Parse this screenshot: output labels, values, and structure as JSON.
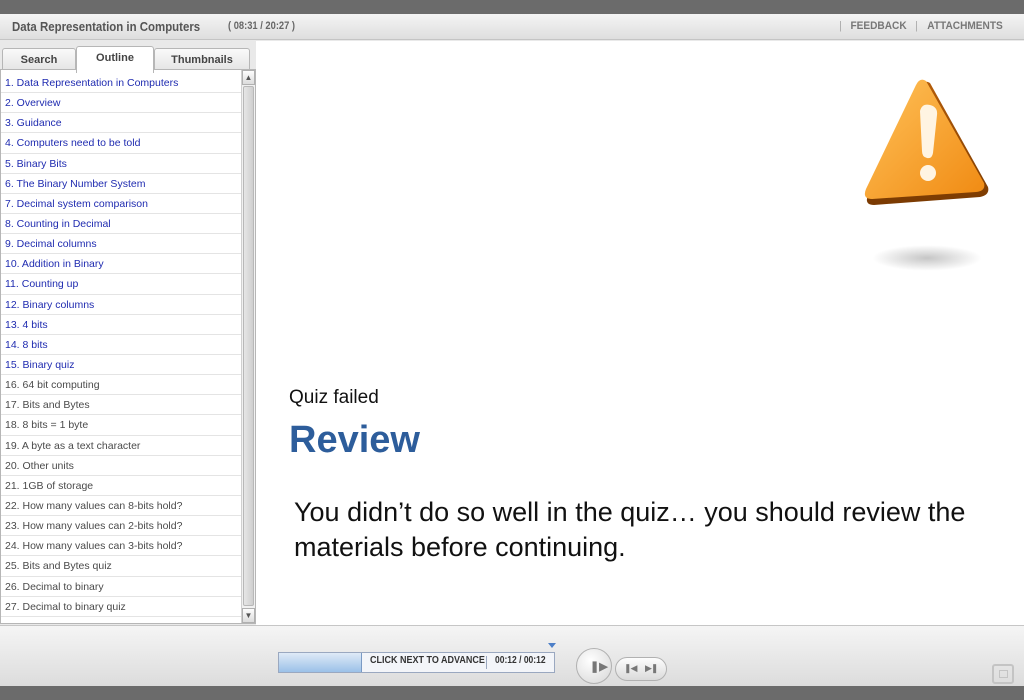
{
  "header": {
    "course_title": "Data Representation in Computers",
    "course_time": "( 08:31 / 20:27 )",
    "feedback_label": "FEEDBACK",
    "attachments_label": "ATTACHMENTS"
  },
  "sidebar": {
    "tabs": [
      {
        "label": "Search"
      },
      {
        "label": "Outline"
      },
      {
        "label": "Thumbnails"
      }
    ],
    "active_tab": "Outline",
    "outline": [
      {
        "label": "1. Data Representation in Computers",
        "visited": true
      },
      {
        "label": "2. Overview",
        "visited": true
      },
      {
        "label": "3. Guidance",
        "visited": true
      },
      {
        "label": "4. Computers need to be told",
        "visited": true
      },
      {
        "label": "5. Binary Bits",
        "visited": true
      },
      {
        "label": "6. The Binary Number System",
        "visited": true
      },
      {
        "label": "7. Decimal system comparison",
        "visited": true
      },
      {
        "label": "8. Counting in Decimal",
        "visited": true
      },
      {
        "label": "9. Decimal columns",
        "visited": true
      },
      {
        "label": "10. Addition in Binary",
        "visited": true
      },
      {
        "label": "11. Counting up",
        "visited": true
      },
      {
        "label": "12. Binary columns",
        "visited": true
      },
      {
        "label": "13. 4 bits",
        "visited": true
      },
      {
        "label": "14. 8 bits",
        "visited": true
      },
      {
        "label": "15. Binary quiz",
        "visited": true
      },
      {
        "label": "16. 64 bit computing",
        "visited": false
      },
      {
        "label": "17. Bits and Bytes",
        "visited": false
      },
      {
        "label": "18. 8 bits = 1 byte",
        "visited": false
      },
      {
        "label": "19. A byte as a text character",
        "visited": false
      },
      {
        "label": "20. Other units",
        "visited": false
      },
      {
        "label": "21. 1GB of storage",
        "visited": false
      },
      {
        "label": "22. How many values can 8-bits hold?",
        "visited": false
      },
      {
        "label": "23. How many values can 2-bits hold?",
        "visited": false
      },
      {
        "label": "24. How many values can 3-bits hold?",
        "visited": false
      },
      {
        "label": "25. Bits and Bytes quiz",
        "visited": false
      },
      {
        "label": "26. Decimal to binary",
        "visited": false
      },
      {
        "label": "27. Decimal to binary quiz",
        "visited": false
      }
    ],
    "scroll_up_icon": "scroll-up-arrow",
    "scroll_down_icon": "scroll-down-arrow"
  },
  "slide": {
    "status": "Quiz failed",
    "heading": "Review",
    "message": "You didn’t do so well in the quiz… you should review the materials before continuing.",
    "icon": "warning-triangle-icon",
    "heading_color": "#2d5d9b",
    "icon_color": "#f39a1e"
  },
  "player": {
    "progress_label": "CLICK NEXT TO ADVANCE",
    "progress_time": "00:12 / 00:12",
    "progress_fraction": 0.3,
    "play_icon": "play-pause-icon",
    "prev_icon": "previous-slide-icon",
    "next_icon": "next-slide-icon",
    "fullscreen_icon": "fullscreen-icon"
  }
}
